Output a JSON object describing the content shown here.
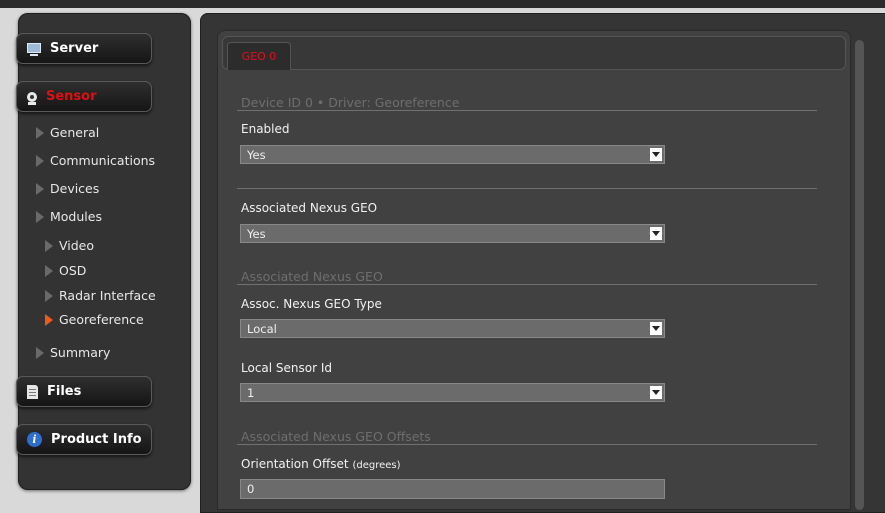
{
  "sidebar": {
    "server_label": "Server",
    "sensor_label": "Sensor",
    "files_label": "Files",
    "product_info_label": "Product Info",
    "nav": {
      "general": "General",
      "communications": "Communications",
      "devices": "Devices",
      "modules": "Modules",
      "video": "Video",
      "osd": "OSD",
      "radar_interface": "Radar Interface",
      "georeference": "Georeference",
      "summary": "Summary"
    },
    "active_color": "#e01010",
    "active_arrow_color": "#f05a1c"
  },
  "main": {
    "tab_label": "GEO 0",
    "device_header": "Device ID 0  •  Driver: Georeference",
    "enabled_label": "Enabled",
    "enabled_value": "Yes",
    "assoc_nexus_geo_label": "Associated Nexus GEO",
    "assoc_nexus_geo_value": "Yes",
    "section_assoc": "Associated Nexus GEO",
    "geo_type_label": "Assoc. Nexus GEO Type",
    "geo_type_value": "Local",
    "local_sensor_label": "Local Sensor Id",
    "local_sensor_value": "1",
    "section_offsets": "Associated Nexus GEO Offsets",
    "orientation_label": "Orientation Offset",
    "orientation_unit": "(degrees)",
    "orientation_value": "0"
  },
  "icons": {
    "server": "monitor-icon",
    "sensor": "webcam-icon",
    "files": "file-icon",
    "product_info": "info-icon"
  }
}
